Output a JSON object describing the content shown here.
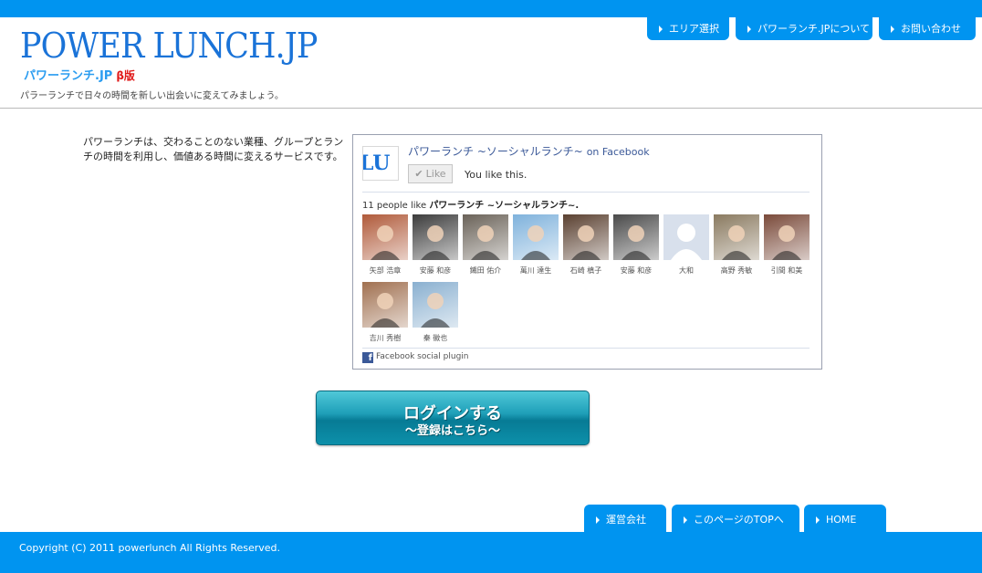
{
  "header": {
    "logo_main": "POWER LUNCH.JP",
    "logo_sub": "パワーランチ.JP",
    "logo_beta": "β版",
    "tagline": "パラーランチで日々の時間を新しい出会いに変えてみましょう。",
    "nav": [
      {
        "label": "エリア選択"
      },
      {
        "label": "パワーランチ.JPについて"
      },
      {
        "label": "お問い合わせ"
      }
    ]
  },
  "main": {
    "intro": "パワーランチは、交わることのない業種、グループとランチの時間を利用し、価値ある時間に変えるサービスです。",
    "facebook": {
      "logo_text": "LU",
      "page_title": "パワーランチ ~ソーシャルランチ~",
      "on_facebook": "on Facebook",
      "like_label": "Like",
      "you_like": "You like this.",
      "count_prefix": "11 people like",
      "count_page": "パワーランチ ~ソーシャルランチ~.",
      "plugin_label": "Facebook social plugin",
      "people": [
        {
          "name": "矢部 浩章",
          "color": "#b05a3a"
        },
        {
          "name": "安藤 和彦",
          "color": "#3c3c3c"
        },
        {
          "name": "鐵田 佑介",
          "color": "#6a6258"
        },
        {
          "name": "萬川 達生",
          "color": "#7fb2dc"
        },
        {
          "name": "石崎 槙子",
          "color": "#5a4030"
        },
        {
          "name": "安藤 和彦",
          "color": "#4a4a4a"
        },
        {
          "name": "大和",
          "color": "#d8e0ec"
        },
        {
          "name": "高野 秀敏",
          "color": "#8a7a60"
        },
        {
          "name": "引間 和美",
          "color": "#7a4a3a"
        },
        {
          "name": "吉川 秀樹",
          "color": "#a07050"
        },
        {
          "name": "秦 徽也",
          "color": "#8ab0d0"
        }
      ]
    },
    "login": {
      "label": "ログインする",
      "sub": "～登録はこちら～"
    }
  },
  "footer": {
    "nav": [
      {
        "label": "運営会社"
      },
      {
        "label": "このページのTOPへ"
      },
      {
        "label": "HOME"
      }
    ],
    "copyright": "Copyright (C) 2011 powerlunch All Rights Reserved."
  },
  "colors": {
    "brand_blue": "#0094f0",
    "logo_blue": "#1a73d8",
    "facebook_blue": "#3b5998",
    "login_teal": "#1e9fb8"
  }
}
